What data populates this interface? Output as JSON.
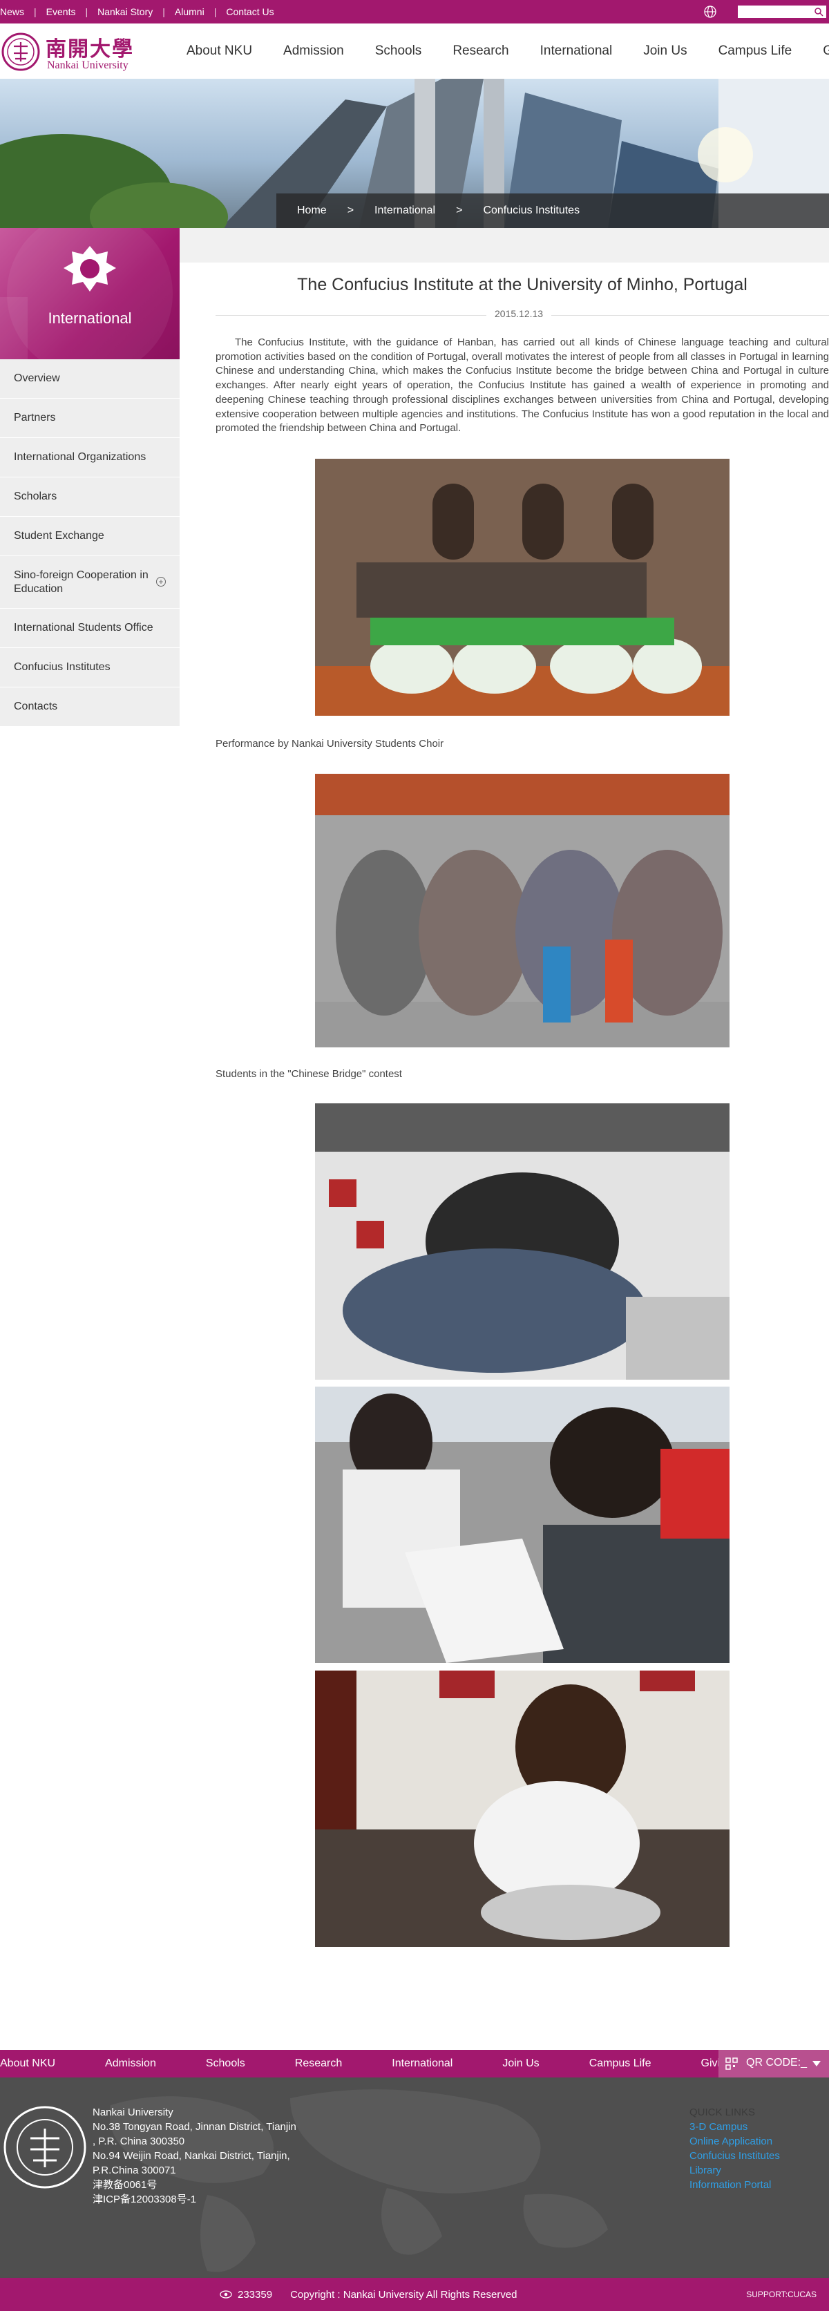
{
  "topbar": {
    "links": [
      "News",
      "Events",
      "Nankai Story",
      "Alumni",
      "Contact Us"
    ],
    "globe_icon": "globe-icon",
    "search_placeholder": ""
  },
  "header": {
    "logo_cn": "南開大學",
    "logo_en": "Nankai University",
    "nav": [
      "About NKU",
      "Admission",
      "Schools",
      "Research",
      "International",
      "Join Us",
      "Campus Life",
      "Giving"
    ]
  },
  "breadcrumb": {
    "home": "Home",
    "sep": ">",
    "section": "International",
    "current": "Confucius Institutes"
  },
  "sidebar": {
    "title": "International",
    "items": [
      {
        "label": "Overview"
      },
      {
        "label": "Partners"
      },
      {
        "label": "International Organizations"
      },
      {
        "label": "Scholars"
      },
      {
        "label": "Student Exchange"
      },
      {
        "label": "Sino-foreign Cooperation in Education",
        "expand": "+"
      },
      {
        "label": "International Students Office"
      },
      {
        "label": "Confucius Institutes"
      },
      {
        "label": "Contacts"
      }
    ]
  },
  "article": {
    "title": "The Confucius Institute at the University of Minho, Portugal",
    "date": "2015.12.13",
    "body": "The Confucius Institute, with the guidance of Hanban, has carried out all kinds of Chinese language teaching and cultural promotion activities based on the condition of Portugal, overall motivates the interest of people from all classes in Portugal in learning Chinese and understanding China, which makes the Confucius Institute become the bridge between China and Portugal in culture exchanges. After nearly eight years of operation, the Confucius Institute has gained a wealth of experience in promoting and deepening Chinese teaching through professional disciplines exchanges between universities from China and Portugal, developing extensive cooperation between multiple agencies and institutions. The Confucius Institute has won a good reputation in the local and promoted the friendship between China and Portugal.",
    "captions": [
      "Performance by Nankai University Students Choir",
      "Students in the \"Chinese Bridge\" contest"
    ]
  },
  "footer": {
    "nav": [
      "About NKU",
      "Admission",
      "Schools",
      "Research",
      "International",
      "Join Us",
      "Campus Life",
      "Giving"
    ],
    "qr_label": "QR CODE:_",
    "address": [
      "Nankai University",
      "No.38 Tongyan Road, Jinnan District, Tianjin",
      ", P.R. China 300350",
      "No.94 Weijin Road,  Nankai District, Tianjin,",
      "P.R.China  300071",
      "津教备0061号",
      "津ICP备12003308号-1"
    ],
    "quick_links_title": "QUICK LINKS",
    "quick_links": [
      "3-D Campus",
      "Online Application",
      "Confucius Institutes",
      "Library",
      "Information Portal"
    ],
    "visits": "233359",
    "copyright": "Copyright : Nankai University All Rights Reserved",
    "support": "SUPPORT:CUCAS"
  },
  "colors": {
    "brand": "#a2186e",
    "footer_bg": "#4f4f4f",
    "link": "#2f9fe6"
  }
}
